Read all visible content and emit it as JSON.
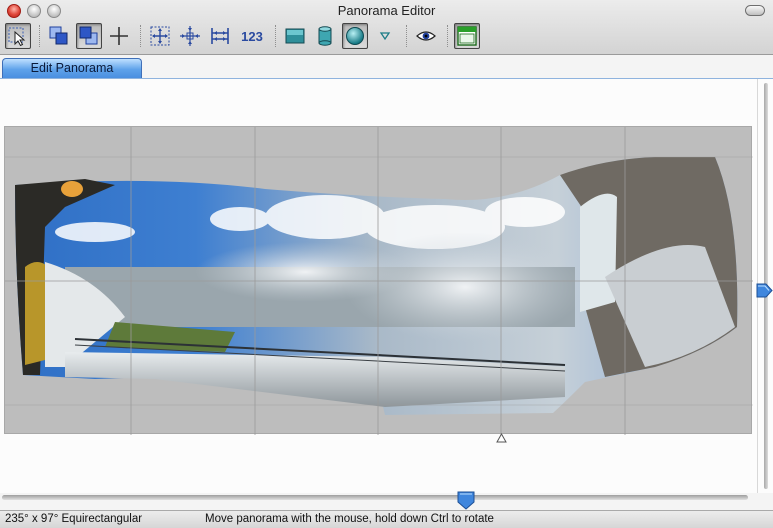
{
  "window": {
    "title": "Panorama Editor"
  },
  "toolbar": {
    "groups": [
      [
        {
          "icon": "select-arrow-icon",
          "pressed": false
        }
      ],
      [
        {
          "icon": "overlap-front-icon",
          "pressed": false
        },
        {
          "icon": "overlap-back-icon",
          "pressed": true
        },
        {
          "icon": "crosshair-icon",
          "pressed": false
        }
      ],
      [
        {
          "icon": "fit-panorama-icon",
          "pressed": false
        },
        {
          "icon": "center-panorama-icon",
          "pressed": false
        },
        {
          "icon": "straighten-icon",
          "pressed": false
        },
        {
          "icon": "number-icon",
          "label": "123",
          "pressed": false
        }
      ],
      [
        {
          "icon": "rectilinear-projection-icon",
          "pressed": false
        },
        {
          "icon": "cylindrical-projection-icon",
          "pressed": false
        },
        {
          "icon": "spherical-projection-icon",
          "pressed": true
        },
        {
          "icon": "dropdown-triangle-icon",
          "pressed": false
        }
      ],
      [
        {
          "icon": "preview-eye-icon",
          "pressed": false
        }
      ],
      [
        {
          "icon": "window-icon",
          "pressed": false
        }
      ]
    ]
  },
  "tabs": [
    {
      "label": "Edit Panorama",
      "active": true
    }
  ],
  "status": {
    "projection": "235° x 97° Equirectangular",
    "hint": "Move panorama with the mouse, hold down Ctrl to rotate"
  },
  "colors": {
    "accent_tab": "#4a8fe0",
    "canvas_background": "#bdbdbd",
    "sky": "#3e7fd1",
    "close_button": "#e0473a"
  },
  "slider": {
    "horizontal_position": 0.62,
    "vertical_position": 0.5
  }
}
